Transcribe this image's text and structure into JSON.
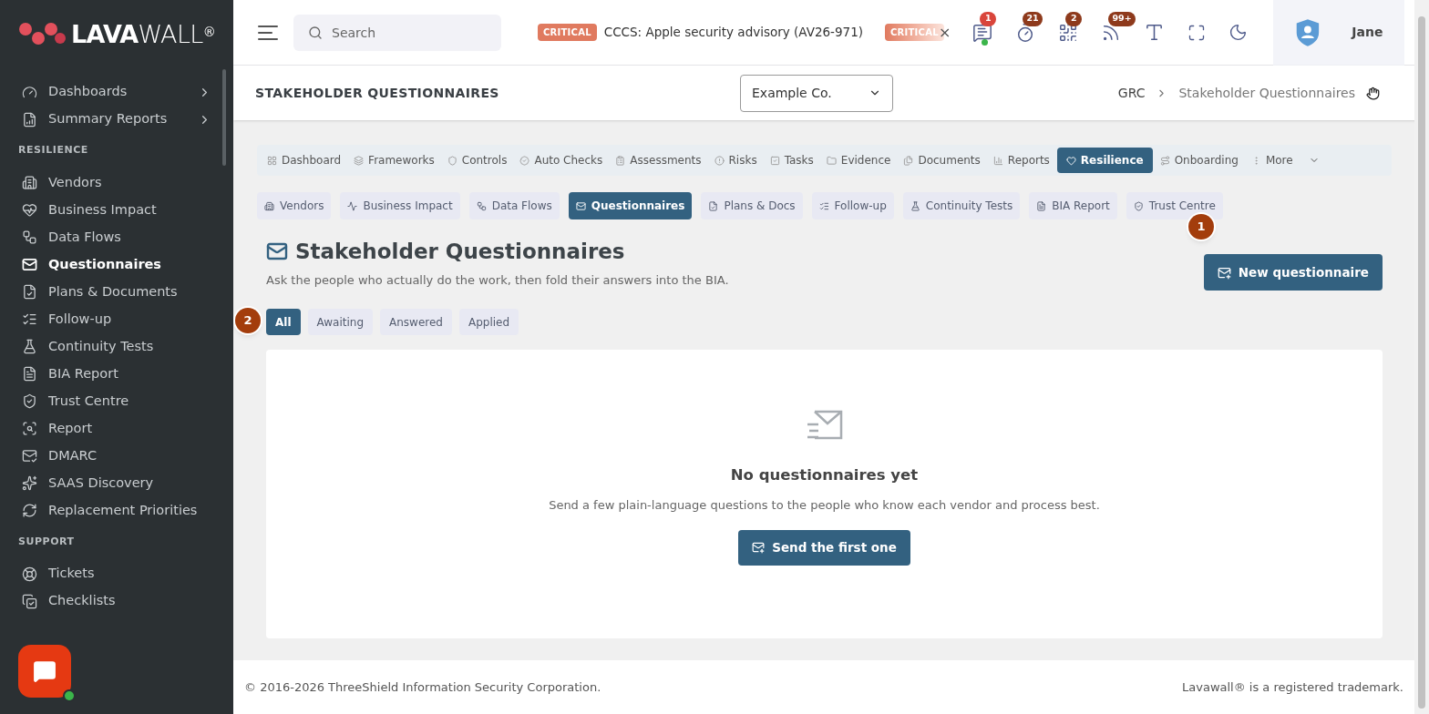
{
  "logo": {
    "bold": "LAVA",
    "light": "WALL",
    "mark": "®"
  },
  "sidebar": {
    "sections": [
      {
        "items": [
          {
            "label": "Dashboards",
            "expandable": true,
            "selected": false
          },
          {
            "label": "Summary Reports",
            "expandable": true,
            "selected": false
          }
        ]
      },
      {
        "heading": "RESILIENCE",
        "items": [
          {
            "label": "Vendors",
            "expandable": false,
            "selected": false
          },
          {
            "label": "Business Impact",
            "expandable": false,
            "selected": false
          },
          {
            "label": "Data Flows",
            "expandable": false,
            "selected": false
          },
          {
            "label": "Questionnaires",
            "expandable": false,
            "selected": true
          },
          {
            "label": "Plans & Documents",
            "expandable": false,
            "selected": false
          },
          {
            "label": "Follow-up",
            "expandable": false,
            "selected": false
          },
          {
            "label": "Continuity Tests",
            "expandable": false,
            "selected": false
          },
          {
            "label": "BIA Report",
            "expandable": false,
            "selected": false
          },
          {
            "label": "Trust Centre",
            "expandable": false,
            "selected": false
          },
          {
            "label": "Report",
            "expandable": false,
            "selected": false
          },
          {
            "label": "DMARC",
            "expandable": false,
            "selected": false
          },
          {
            "label": "SAAS Discovery",
            "expandable": false,
            "selected": false
          },
          {
            "label": "Replacement Priorities",
            "expandable": false,
            "selected": false
          }
        ]
      },
      {
        "heading": "SUPPORT",
        "items": [
          {
            "label": "Tickets",
            "expandable": false,
            "selected": false
          },
          {
            "label": "Checklists",
            "expandable": false,
            "selected": false
          }
        ]
      }
    ]
  },
  "topbar": {
    "search": {
      "placeholder": "Search"
    },
    "ticker": [
      {
        "badge": "CRITICAL",
        "text": "CCCS: Apple security advisory (AV26-971)"
      },
      {
        "badge": "CRITICAL"
      }
    ],
    "close": "×",
    "badges": [
      "1",
      "21",
      "2",
      "99+"
    ],
    "user": {
      "name": "Jane"
    }
  },
  "page_header": {
    "title": "STAKEHOLDER QUESTIONNAIRES",
    "company": "Example Co.",
    "breadcrumb": [
      "GRC",
      "Stakeholder Questionnaires"
    ]
  },
  "module_tabs": [
    {
      "label": "Dashboard",
      "selected": false
    },
    {
      "label": "Frameworks",
      "selected": false
    },
    {
      "label": "Controls",
      "selected": false
    },
    {
      "label": "Auto Checks",
      "selected": false
    },
    {
      "label": "Assessments",
      "selected": false
    },
    {
      "label": "Risks",
      "selected": false
    },
    {
      "label": "Tasks",
      "selected": false
    },
    {
      "label": "Evidence",
      "selected": false
    },
    {
      "label": "Documents",
      "selected": false
    },
    {
      "label": "Reports",
      "selected": false
    },
    {
      "label": "Resilience",
      "selected": true
    },
    {
      "label": "Onboarding",
      "selected": false
    },
    {
      "label": "More",
      "selected": false
    }
  ],
  "sub_tabs": [
    {
      "label": "Vendors",
      "selected": false
    },
    {
      "label": "Business Impact",
      "selected": false
    },
    {
      "label": "Data Flows",
      "selected": false
    },
    {
      "label": "Questionnaires",
      "selected": true
    },
    {
      "label": "Plans & Docs",
      "selected": false
    },
    {
      "label": "Follow-up",
      "selected": false
    },
    {
      "label": "Continuity Tests",
      "selected": false
    },
    {
      "label": "BIA Report",
      "selected": false
    },
    {
      "label": "Trust Centre",
      "selected": false
    }
  ],
  "heading": {
    "title": "Stakeholder Questionnaires",
    "subtitle": "Ask the people who actually do the work, then fold their answers into the BIA.",
    "action": "New questionnaire"
  },
  "filters": [
    {
      "label": "All",
      "selected": true
    },
    {
      "label": "Awaiting",
      "selected": false
    },
    {
      "label": "Answered",
      "selected": false
    },
    {
      "label": "Applied",
      "selected": false
    }
  ],
  "tour_markers": [
    "1",
    "2"
  ],
  "empty_state": {
    "title": "No questionnaires yet",
    "text": "Send a few plain-language questions to the people who know each vendor and process best.",
    "button": "Send the first one"
  },
  "footer": {
    "copyright": "© 2016-2026 ThreeShield Information Security Corporation.",
    "trademark": "Lavawall® is a registered trademark."
  }
}
